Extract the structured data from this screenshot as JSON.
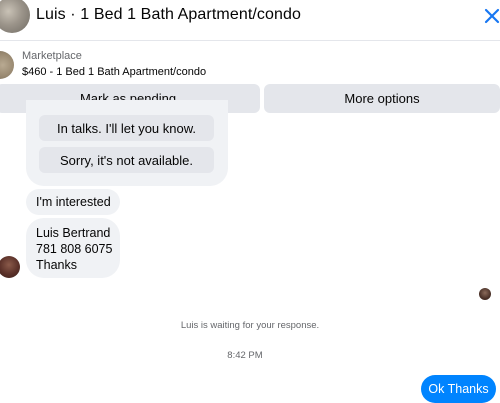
{
  "header": {
    "title": "Luis · 1 Bed 1 Bath Apartment/condo",
    "close_icon": "close-icon"
  },
  "marketplace": {
    "label": "Marketplace",
    "listing": "$460 - 1 Bed 1 Bath Apartment/condo",
    "mark_pending_label": "Mark as pending",
    "more_options_label": "More options"
  },
  "messages": {
    "quick_replies": [
      "In talks. I'll let you know.",
      "Sorry, it's not available."
    ],
    "interested": "I'm interested",
    "contact_lines": [
      "Luis Bertrand",
      "781 808 6075",
      "Thanks"
    ],
    "waiting": "Luis is waiting for your response.",
    "time": "8:42 PM",
    "my_reply": "Ok Thanks"
  },
  "colors": {
    "accent_blue": "#0084ff",
    "bubble_gray": "#f0f2f5",
    "button_gray": "#e4e6eb",
    "muted_text": "#65676b"
  }
}
